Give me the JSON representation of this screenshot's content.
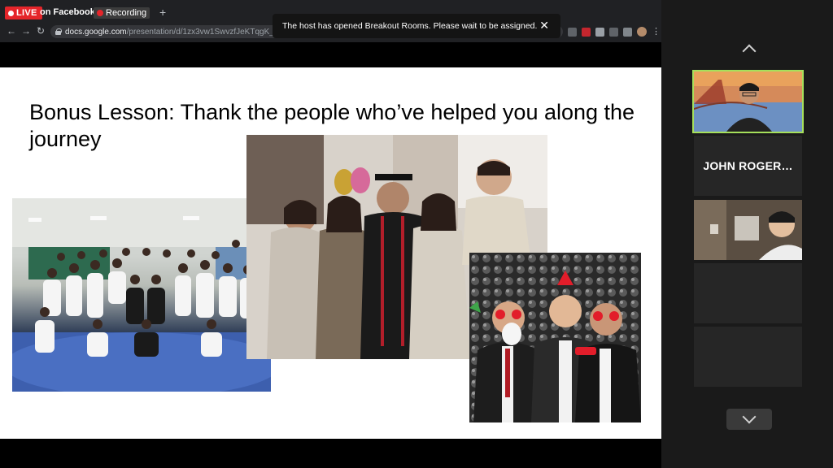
{
  "browser": {
    "live_label": "LIVE",
    "tab_label": "on Facebook",
    "recording_label": "Recording",
    "new_tab": "+",
    "url_host": "docs.google.com",
    "url_path": "/presentation/d/1zx3vw1SwvzfJeKTqgK_cksUrQ…"
  },
  "notification": {
    "message": "The host has opened Breakout Rooms. Please wait to be assigned.",
    "close_symbol": "✕"
  },
  "slide": {
    "title": "Bonus Lesson: Thank the people who’ve helped you along the journey"
  },
  "participants": {
    "tiles": [
      {
        "name": "",
        "type": "video"
      },
      {
        "name": "JOHN ROGER…",
        "type": "name"
      },
      {
        "name": "",
        "type": "video"
      },
      {
        "name": "",
        "type": "empty"
      },
      {
        "name": "",
        "type": "empty"
      }
    ]
  },
  "colors": {
    "active_speaker_border": "#a6e05b",
    "live_red": "#e5252a"
  }
}
